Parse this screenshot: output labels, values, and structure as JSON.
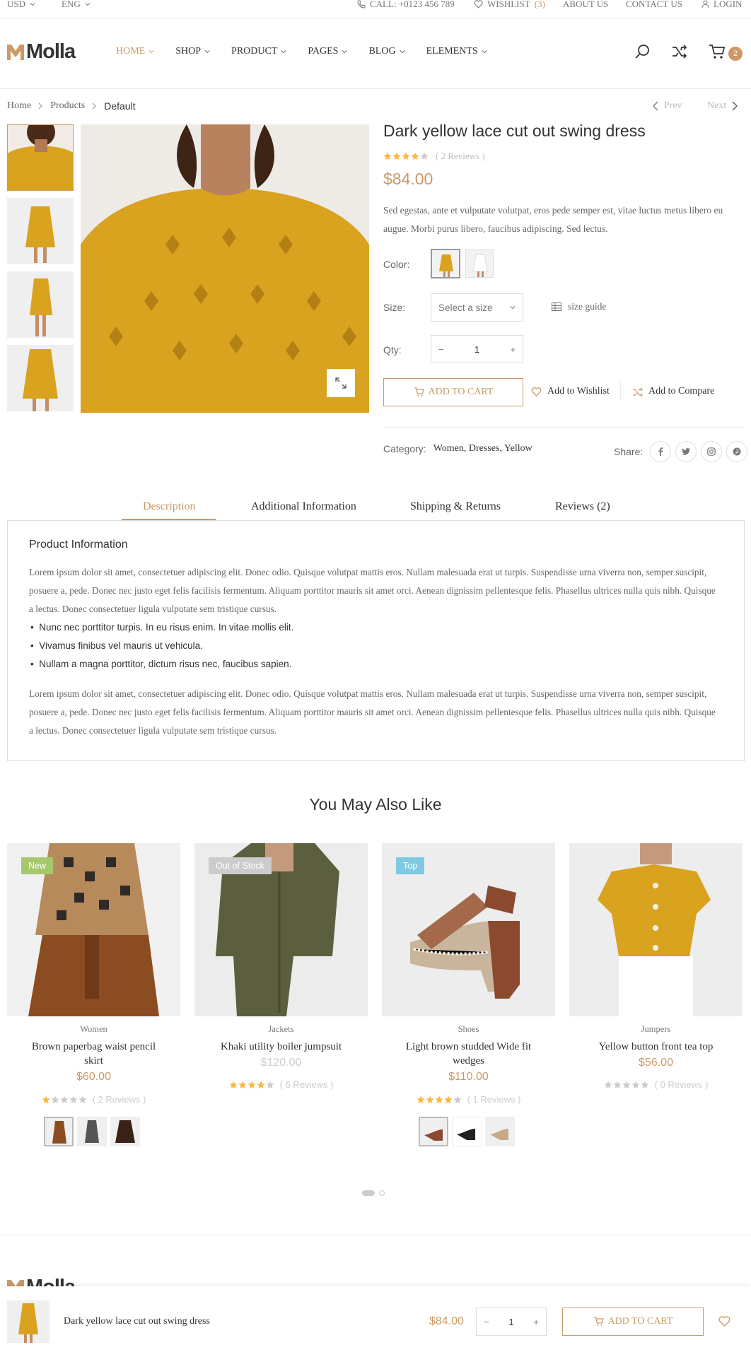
{
  "topbar": {
    "currency": "USD",
    "language": "ENG",
    "phone": "CALL: +0123 456 789",
    "wishlist_label": "WISHLIST",
    "wishlist_count": "(3)",
    "about": "ABOUT US",
    "contact": "CONTACT US",
    "login": "LOGIN"
  },
  "header": {
    "logo": "Molla",
    "nav": [
      "HOME",
      "SHOP",
      "PRODUCT",
      "PAGES",
      "BLOG",
      "ELEMENTS"
    ],
    "cart_count": "2"
  },
  "breadcrumb": {
    "items": [
      "Home",
      "Products",
      "Default"
    ],
    "prev": "Prev",
    "next": "Next"
  },
  "product": {
    "title": "Dark yellow lace cut out swing dress",
    "rating": 4,
    "reviews": "( 2 Reviews )",
    "price": "$84.00",
    "description": "Sed egestas, ante et vulputate volutpat, eros pede semper est, vitae luctus metus libero eu augue. Morbi purus libero, faucibus adipiscing. Sed lectus.",
    "color_label": "Color:",
    "size_label": "Size:",
    "size_placeholder": "Select a size",
    "size_guide": "size guide",
    "qty_label": "Qty:",
    "qty_value": "1",
    "qty_minus": "−",
    "qty_plus": "+",
    "add_to_cart": "ADD TO CART",
    "add_to_wishlist": "Add to Wishlist",
    "add_to_compare": "Add to Compare",
    "category_label": "Category:",
    "categories": "Women, Dresses, Yellow",
    "share_label": "Share:"
  },
  "tabs": [
    "Description",
    "Additional Information",
    "Shipping & Returns",
    "Reviews (2)"
  ],
  "description": {
    "heading": "Product Information",
    "para1": "Lorem ipsum dolor sit amet, consectetuer adipiscing elit. Donec odio. Quisque volutpat mattis eros. Nullam malesuada erat ut turpis. Suspendisse urna viverra non, semper suscipit, posuere a, pede. Donec nec justo eget felis facilisis fermentum. Aliquam porttitor mauris sit amet orci. Aenean dignissim pellentesque felis. Phasellus ultrices nulla quis nibh. Quisque a lectus. Donec consectetuer ligula vulputate sem tristique cursus.",
    "bullets": [
      "Nunc nec porttitor turpis. In eu risus enim. In vitae mollis elit.",
      "Vivamus finibus vel mauris ut vehicula.",
      "Nullam a magna porttitor, dictum risus nec, faucibus sapien."
    ],
    "para2": "Lorem ipsum dolor sit amet, consectetuer adipiscing elit. Donec odio. Quisque volutpat mattis eros. Nullam malesuada erat ut turpis. Suspendisse urna viverra non, semper suscipit, posuere a, pede. Donec nec justo eget felis facilisis fermentum. Aliquam porttitor mauris sit amet orci. Aenean dignissim pellentesque felis. Phasellus ultrices nulla quis nibh. Quisque a lectus. Donec consectetuer ligula vulputate sem tristique cursus."
  },
  "related": {
    "heading": "You May Also Like",
    "products": [
      {
        "tag": "New",
        "category": "Women",
        "name": "Brown paperbag waist pencil skirt",
        "price": "$60.00",
        "rating": 1,
        "reviews": "( 2 Reviews )"
      },
      {
        "tag": "Out of Stock",
        "category": "Jackets",
        "name": "Khaki utility boiler jumpsuit",
        "price": "$120.00",
        "rating": 4,
        "reviews": "( 6 Reviews )"
      },
      {
        "tag": "Top",
        "category": "Shoes",
        "name": "Light brown studded Wide fit wedges",
        "price": "$110.00",
        "rating": 4,
        "reviews": "( 1 Reviews )"
      },
      {
        "tag": "",
        "category": "Jumpers",
        "name": "Yellow button front tea top",
        "price": "$56.00",
        "rating": 0,
        "reviews": "( 0 Reviews )"
      }
    ]
  },
  "sticky": {
    "name": "Dark yellow lace cut out swing dress",
    "price": "$84.00",
    "qty": "1",
    "qty_minus": "−",
    "qty_plus": "+",
    "add_to_cart": "ADD TO CART"
  },
  "colors": {
    "accent": "#cc9966",
    "tag_new": "#a6c76c",
    "tag_out": "#cccccc",
    "tag_top": "#7fc9e3"
  }
}
